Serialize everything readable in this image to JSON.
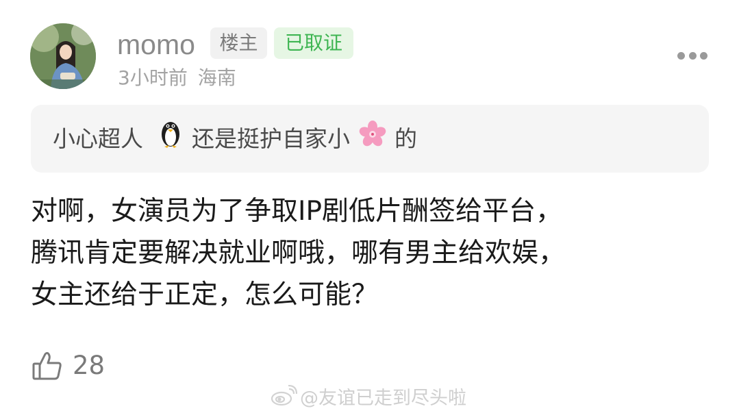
{
  "post": {
    "username": "momo",
    "owner_badge": "楼主",
    "cert_badge": "已取证",
    "time": "3小时前",
    "location": "海南",
    "quote": {
      "author": "小心超人",
      "text_before_emoji": "还是挺护自家小",
      "text_after_emoji": "的"
    },
    "body_lines": [
      "对啊，女演员为了争取IP剧低片酬签给平台，",
      "腾讯肯定要解决就业啊哦，哪有男主给欢娱，",
      "女主还给于正定，怎么可能？"
    ],
    "like_count": "28"
  },
  "watermark": {
    "text": "@友谊已走到尽头啦"
  },
  "icons": {
    "more": "more-dots-icon",
    "like": "thumbs-up-icon",
    "quote_penguin": "penguin-emoji",
    "quote_flower": "cherry-blossom-emoji",
    "watermark": "weibo-logo-icon"
  },
  "colors": {
    "cert_green": "#3eb552",
    "muted_gray": "#8a8a8a",
    "quote_bg": "#f5f5f5"
  }
}
